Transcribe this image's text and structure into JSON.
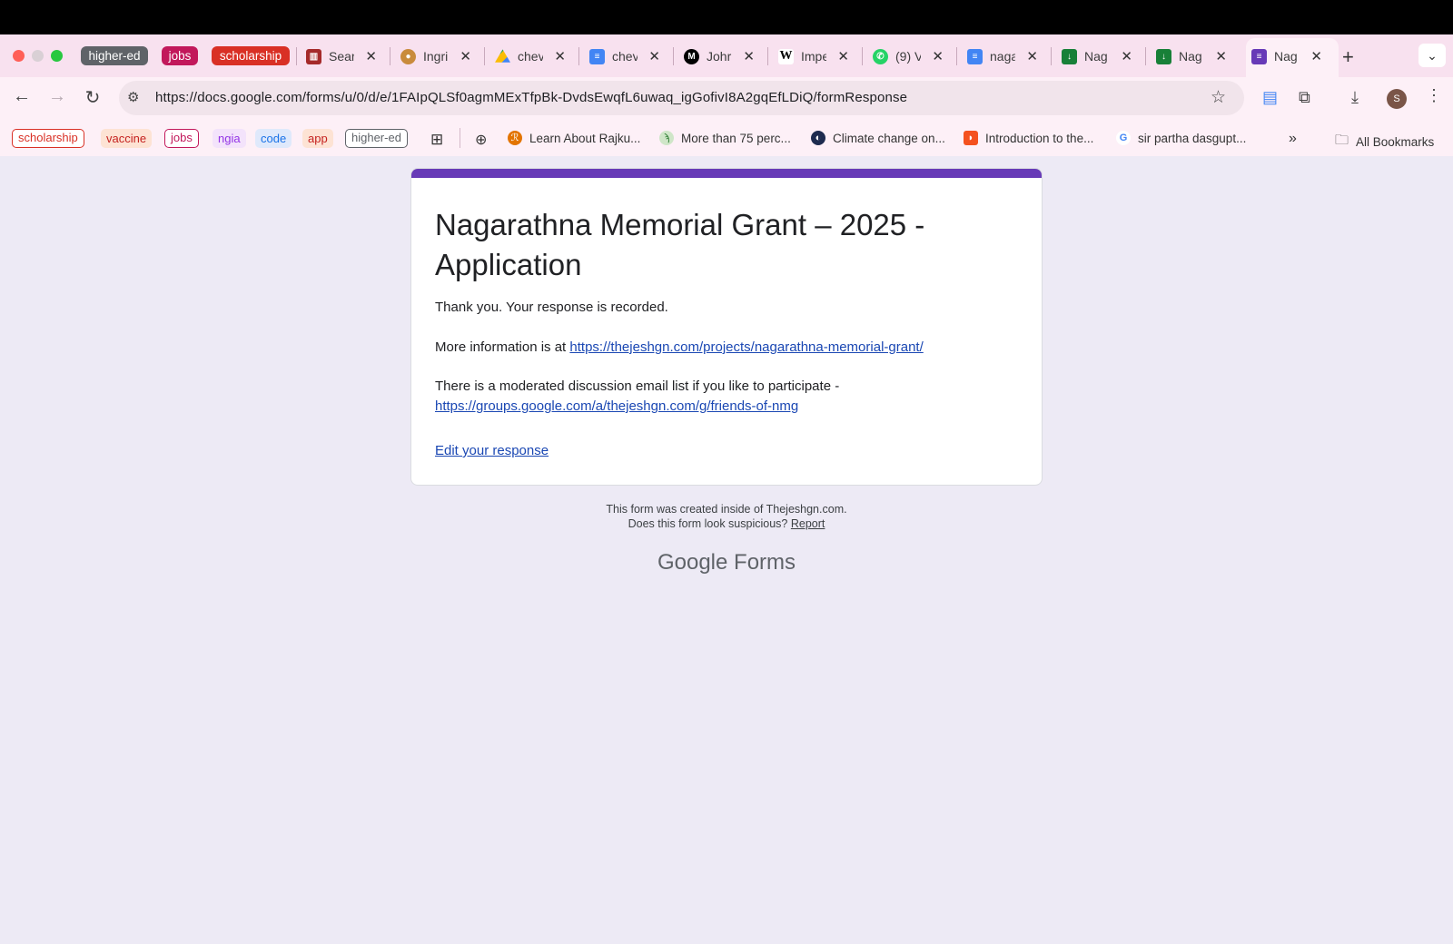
{
  "browser": {
    "tab_groups": [
      {
        "label": "higher-ed",
        "color": "#5f6368"
      },
      {
        "label": "jobs",
        "color": "#c2185b"
      },
      {
        "label": "scholarship",
        "color": "#d93025"
      }
    ],
    "tabs": [
      {
        "title": "Sear",
        "icon": "book-icon"
      },
      {
        "title": "Ingri",
        "icon": "person-icon"
      },
      {
        "title": "chev",
        "icon": "drive-icon"
      },
      {
        "title": "chev",
        "icon": "docs-icon"
      },
      {
        "title": "Johr",
        "icon": "medium-icon"
      },
      {
        "title": "Impe",
        "icon": "wikipedia-icon"
      },
      {
        "title": "(9) V",
        "icon": "whatsapp-icon"
      },
      {
        "title": "naga",
        "icon": "docs-icon"
      },
      {
        "title": "Nag",
        "icon": "download-icon"
      },
      {
        "title": "Nag",
        "icon": "download-icon"
      },
      {
        "title": "Nag",
        "icon": "forms-icon"
      }
    ],
    "url": "https://docs.google.com/forms/u/0/d/e/1FAIpQLSf0agmMExTfpBk-DvdsEwqfL6uwaq_igGofivI8A2gqEfLDiQ/formResponse",
    "avatar_letter": "S",
    "bookmark_chips": [
      {
        "label": "scholarship",
        "color": "#d93025"
      },
      {
        "label": "vaccine",
        "color": "#e8710a"
      },
      {
        "label": "jobs",
        "color": "#c2185b"
      },
      {
        "label": "ngia",
        "color": "#9334e6"
      },
      {
        "label": "code",
        "color": "#1a73e8"
      },
      {
        "label": "app",
        "color": "#e8710a"
      },
      {
        "label": "higher-ed",
        "color": "#5f6368"
      }
    ],
    "bookmarks": [
      {
        "label": "Learn About Rajku..."
      },
      {
        "label": "More than 75 perc..."
      },
      {
        "label": "Climate change on..."
      },
      {
        "label": "Introduction to the..."
      },
      {
        "label": "sir partha dasgupt..."
      }
    ],
    "all_bookmarks": "All Bookmarks"
  },
  "form": {
    "accent_color": "#673ab7",
    "title": "Nagarathna Memorial Grant – 2025  - Application",
    "confirmation": "Thank you. Your response is recorded.",
    "more_info_prefix": "More information is at ",
    "more_info_link": "https://thejeshgn.com/projects/nagarathna-memorial-grant/",
    "discussion_text": "There is a moderated discussion email list if you like to participate -",
    "discussion_link": "https://groups.google.com/a/thejeshgn.com/g/friends-of-nmg",
    "edit_link": "Edit your response",
    "footer_created": "This form was created inside of Thejeshgn.com.",
    "footer_suspicious": "Does this form look suspicious?",
    "footer_report": "Report",
    "brand_google": "Google",
    "brand_forms": "Forms"
  }
}
